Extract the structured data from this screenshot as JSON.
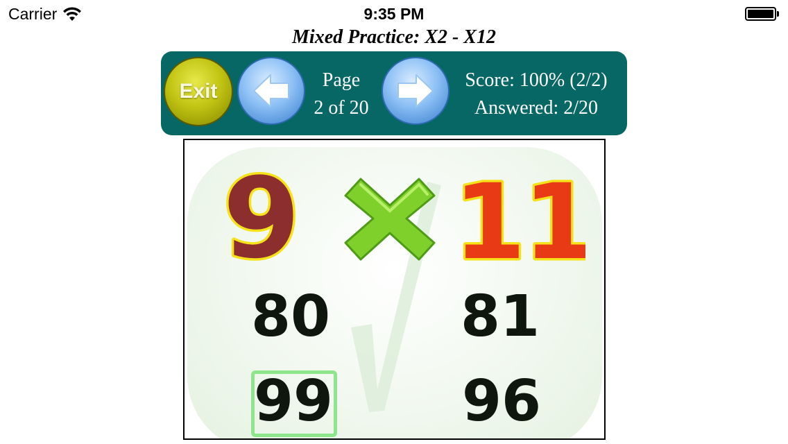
{
  "status_bar": {
    "carrier": "Carrier",
    "time": "9:35 PM",
    "wifi_icon": "wifi-icon",
    "battery_icon": "battery-icon"
  },
  "title": "Mixed Practice: X2 - X12",
  "toolbar": {
    "exit_label": "Exit",
    "prev_icon": "left-arrow-icon",
    "next_icon": "right-arrow-icon",
    "page_label": "Page",
    "page_count": "2 of 20",
    "score": "Score: 100% (2/2)",
    "answered": "Answered: 2/20",
    "colors": {
      "toolbar_bg": "#066764",
      "exit": "#c2c414",
      "nav": "#8dc0f5"
    }
  },
  "question": {
    "factor_a": "9",
    "operator": "×",
    "factor_b": "11",
    "answers": [
      "80",
      "81",
      "99",
      "96"
    ],
    "selected": "99",
    "colors": {
      "selection": "#8ee68c",
      "factor_fill": "#8d2e2e",
      "factor_b_fill": "#e83a15",
      "outline": "#f5e21a",
      "times": "#7fd02a"
    }
  }
}
